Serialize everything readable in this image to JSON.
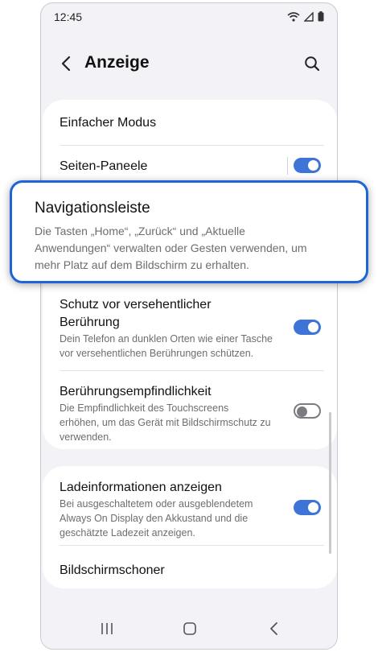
{
  "status": {
    "time": "12:45"
  },
  "header": {
    "title": "Anzeige"
  },
  "settings": {
    "simple_mode": {
      "title": "Einfacher Modus"
    },
    "edge_panels": {
      "title": "Seiten-Paneele",
      "enabled": true
    },
    "accidental_touch": {
      "title_line1": "Schutz vor versehentlicher",
      "title_line2": "Berührung",
      "desc_line1": "Dein Telefon an dunklen Orten wie einer Tasche",
      "desc_line2": "vor versehentlichen Berührungen schützen.",
      "enabled": true
    },
    "touch_sensitivity": {
      "title": "Berührungsempfindlichkeit",
      "desc_line1": "Die Empfindlichkeit des Touchscreens",
      "desc_line2": "erhöhen, um das Gerät mit Bildschirmschutz zu",
      "desc_line3": "verwenden.",
      "enabled": false
    },
    "charging_info": {
      "title": "Ladeinformationen anzeigen",
      "desc_line1": "Bei ausgeschaltetem oder ausgeblendetem",
      "desc_line2": "Always On Display den Akkustand und die",
      "desc_line3": "geschätzte Ladezeit anzeigen.",
      "enabled": true
    },
    "screensaver": {
      "title": "Bildschirmschoner"
    }
  },
  "callout": {
    "title": "Navigationsleiste",
    "desc_line1": "Die Tasten „Home“, „Zurück“ und „Aktuelle",
    "desc_line2": "Anwendungen“ verwalten oder Gesten verwenden, um",
    "desc_line3": "mehr Platz auf dem Bildschirm zu erhalten."
  },
  "colors": {
    "accent": "#3e73d8",
    "callout_border": "#1f64d6",
    "background": "#f3f2f7"
  },
  "icons": {
    "back": "back-arrow-icon",
    "search": "search-icon",
    "wifi": "wifi-icon",
    "signal": "signal-icon",
    "battery": "battery-icon",
    "recents": "recents-icon",
    "home": "home-icon",
    "nav_back": "nav-back-icon"
  }
}
